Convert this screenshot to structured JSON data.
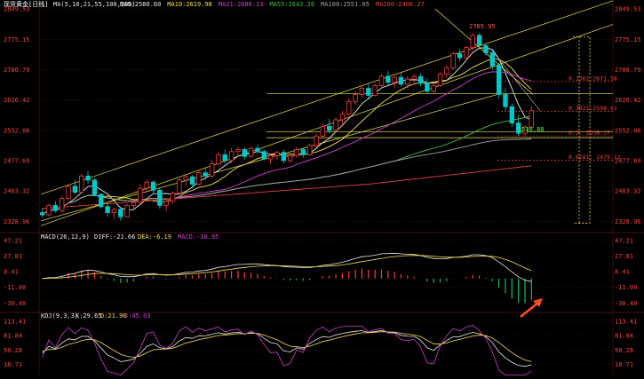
{
  "header": {
    "symbol": "现货黄金[日线]",
    "ma_label": "MA(5,10,21,55,100,200)",
    "ma_items": [
      {
        "label": "MA5:2580.60",
        "color": "#e8e8e8"
      },
      {
        "label": "MA10:2619.98",
        "color": "#f0e040"
      },
      {
        "label": "MA21:2686.13",
        "color": "#d040d0"
      },
      {
        "label": "MA55:2642.26",
        "color": "#40c040"
      },
      {
        "label": "MA100:2551.05",
        "color": "#a0a0a0"
      },
      {
        "label": "MA200:2406.27",
        "color": "#e04040"
      }
    ]
  },
  "colors": {
    "up": "#ff3a3a",
    "down": "#00c8c8",
    "grid": "#3a1010",
    "axis_text": "#ff4040",
    "fib": "#ff4040",
    "channel": "#e8e840",
    "arrow": "#ff5020"
  },
  "chart_data": [
    {
      "type": "candlestick",
      "panel": "price",
      "yticks": [
        2849.53,
        2775.15,
        2700.79,
        2626.42,
        2552.06,
        2477.69,
        2403.32,
        2328.96
      ],
      "ylim": [
        2310,
        2850
      ],
      "annotations": {
        "high": "2789.95",
        "low": "2536.88"
      },
      "fib_levels": [
        {
          "label": "0.2361:2671.58",
          "value": 2671.58
        },
        {
          "label": "0.3821:2598.01",
          "value": 2598.01
        },
        {
          "label": "0.5: 2538.37",
          "value": 2538.37
        },
        {
          "label": "0.6181: 2479.12",
          "value": 2479.12
        }
      ],
      "ohlc": [
        [
          2350,
          2362,
          2338,
          2345
        ],
        [
          2345,
          2372,
          2340,
          2368
        ],
        [
          2368,
          2378,
          2350,
          2355
        ],
        [
          2355,
          2390,
          2350,
          2385
        ],
        [
          2385,
          2420,
          2380,
          2415
        ],
        [
          2415,
          2430,
          2395,
          2400
        ],
        [
          2400,
          2445,
          2398,
          2440
        ],
        [
          2440,
          2452,
          2420,
          2430
        ],
        [
          2430,
          2435,
          2390,
          2395
        ],
        [
          2395,
          2398,
          2360,
          2365
        ],
        [
          2365,
          2372,
          2340,
          2350
        ],
        [
          2350,
          2362,
          2335,
          2358
        ],
        [
          2358,
          2365,
          2330,
          2340
        ],
        [
          2340,
          2372,
          2338,
          2368
        ],
        [
          2368,
          2385,
          2355,
          2375
        ],
        [
          2375,
          2420,
          2370,
          2410
        ],
        [
          2410,
          2430,
          2400,
          2425
        ],
        [
          2425,
          2430,
          2395,
          2405
        ],
        [
          2405,
          2410,
          2360,
          2368
        ],
        [
          2368,
          2382,
          2355,
          2378
        ],
        [
          2378,
          2402,
          2372,
          2398
        ],
        [
          2398,
          2435,
          2395,
          2430
        ],
        [
          2430,
          2445,
          2415,
          2438
        ],
        [
          2438,
          2442,
          2410,
          2420
        ],
        [
          2420,
          2455,
          2418,
          2448
        ],
        [
          2448,
          2460,
          2430,
          2440
        ],
        [
          2440,
          2480,
          2435,
          2470
        ],
        [
          2470,
          2500,
          2465,
          2492
        ],
        [
          2492,
          2505,
          2470,
          2478
        ],
        [
          2478,
          2508,
          2472,
          2500
        ],
        [
          2500,
          2512,
          2488,
          2505
        ],
        [
          2505,
          2510,
          2480,
          2488
        ],
        [
          2488,
          2512,
          2485,
          2508
        ],
        [
          2508,
          2518,
          2495,
          2500
        ],
        [
          2500,
          2505,
          2478,
          2482
        ],
        [
          2482,
          2495,
          2470,
          2490
        ],
        [
          2490,
          2502,
          2480,
          2498
        ],
        [
          2498,
          2505,
          2470,
          2478
        ],
        [
          2478,
          2495,
          2472,
          2490
        ],
        [
          2490,
          2512,
          2485,
          2505
        ],
        [
          2505,
          2510,
          2485,
          2492
        ],
        [
          2492,
          2520,
          2490,
          2515
        ],
        [
          2515,
          2545,
          2510,
          2538
        ],
        [
          2538,
          2570,
          2532,
          2562
        ],
        [
          2562,
          2580,
          2545,
          2552
        ],
        [
          2552,
          2585,
          2548,
          2578
        ],
        [
          2578,
          2600,
          2565,
          2592
        ],
        [
          2592,
          2630,
          2588,
          2622
        ],
        [
          2622,
          2648,
          2615,
          2640
        ],
        [
          2640,
          2662,
          2632,
          2655
        ],
        [
          2655,
          2668,
          2630,
          2638
        ],
        [
          2638,
          2668,
          2635,
          2662
        ],
        [
          2662,
          2690,
          2655,
          2685
        ],
        [
          2685,
          2698,
          2662,
          2670
        ],
        [
          2670,
          2690,
          2655,
          2682
        ],
        [
          2682,
          2695,
          2660,
          2665
        ],
        [
          2665,
          2685,
          2655,
          2678
        ],
        [
          2678,
          2690,
          2668,
          2684
        ],
        [
          2684,
          2692,
          2660,
          2668
        ],
        [
          2668,
          2680,
          2640,
          2648
        ],
        [
          2648,
          2668,
          2640,
          2662
        ],
        [
          2662,
          2695,
          2658,
          2690
        ],
        [
          2690,
          2712,
          2680,
          2705
        ],
        [
          2705,
          2745,
          2700,
          2740
        ],
        [
          2740,
          2752,
          2722,
          2730
        ],
        [
          2730,
          2760,
          2725,
          2755
        ],
        [
          2755,
          2790,
          2748,
          2785
        ],
        [
          2785,
          2790,
          2750,
          2760
        ],
        [
          2760,
          2765,
          2735,
          2742
        ],
        [
          2742,
          2750,
          2700,
          2710
        ],
        [
          2710,
          2718,
          2630,
          2640
        ],
        [
          2640,
          2655,
          2600,
          2610
        ],
        [
          2610,
          2618,
          2560,
          2570
        ],
        [
          2570,
          2590,
          2538,
          2545
        ],
        [
          2545,
          2565,
          2537,
          2560
        ],
        [
          2560,
          2612,
          2555,
          2600
        ]
      ]
    },
    {
      "type": "line+bar",
      "panel": "macd",
      "title": "MACD(26,12,9)",
      "labels": {
        "diff": "DIFF:-21.66",
        "dea": "DEA:-6.19",
        "macd": "MACD:-30.95"
      },
      "yticks": [
        47.21,
        27.81,
        8.41,
        -11.0,
        -30.4
      ]
    },
    {
      "type": "line",
      "panel": "kdj",
      "title": "KDJ(9,3,3)",
      "labels": {
        "k": "K:29.65",
        "d": "D:21.96",
        "j": "J:45.03"
      },
      "yticks": [
        113.41,
        81.84,
        50.28,
        18.71
      ]
    }
  ]
}
